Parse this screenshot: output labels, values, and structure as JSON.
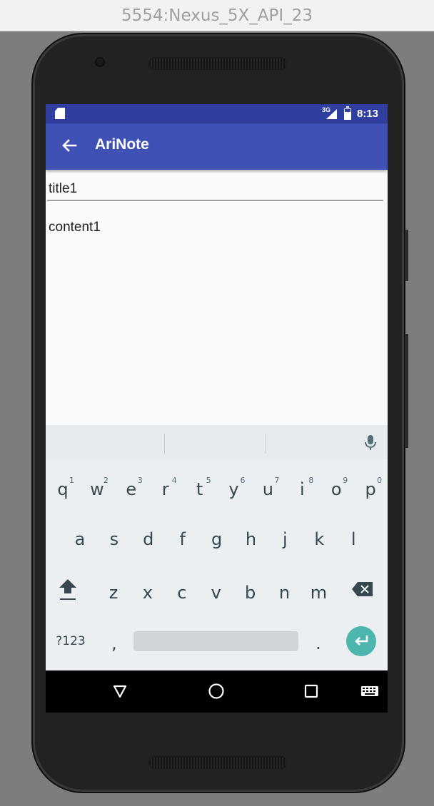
{
  "window_title": "5554:Nexus_5X_API_23",
  "status_bar": {
    "network": "3G",
    "signal_suffix": "!",
    "time": "8:13"
  },
  "app_bar": {
    "title": "AriNote"
  },
  "note": {
    "title": "title1",
    "content": "content1"
  },
  "keyboard": {
    "row1": [
      {
        "k": "q",
        "h": "1"
      },
      {
        "k": "w",
        "h": "2"
      },
      {
        "k": "e",
        "h": "3"
      },
      {
        "k": "r",
        "h": "4"
      },
      {
        "k": "t",
        "h": "5"
      },
      {
        "k": "y",
        "h": "6"
      },
      {
        "k": "u",
        "h": "7"
      },
      {
        "k": "i",
        "h": "8"
      },
      {
        "k": "o",
        "h": "9"
      },
      {
        "k": "p",
        "h": "0"
      }
    ],
    "row2": [
      "a",
      "s",
      "d",
      "f",
      "g",
      "h",
      "j",
      "k",
      "l"
    ],
    "row3": [
      "z",
      "x",
      "c",
      "v",
      "b",
      "n",
      "m"
    ],
    "symbols_label": "?123",
    "comma_label": ",",
    "period_label": "."
  },
  "colors": {
    "status_bar": "#303f9f",
    "app_bar": "#3f51b5",
    "enter_key": "#4db6ac",
    "keyboard_bg": "#eceff1"
  },
  "icons": {
    "back": "arrow-back-icon",
    "mic": "microphone-icon",
    "shift": "shift-icon",
    "backspace": "backspace-icon",
    "enter": "enter-icon",
    "nav_back": "triangle-back-icon",
    "nav_home": "circle-home-icon",
    "nav_recents": "square-recents-icon",
    "nav_keyboard": "keyboard-icon"
  }
}
